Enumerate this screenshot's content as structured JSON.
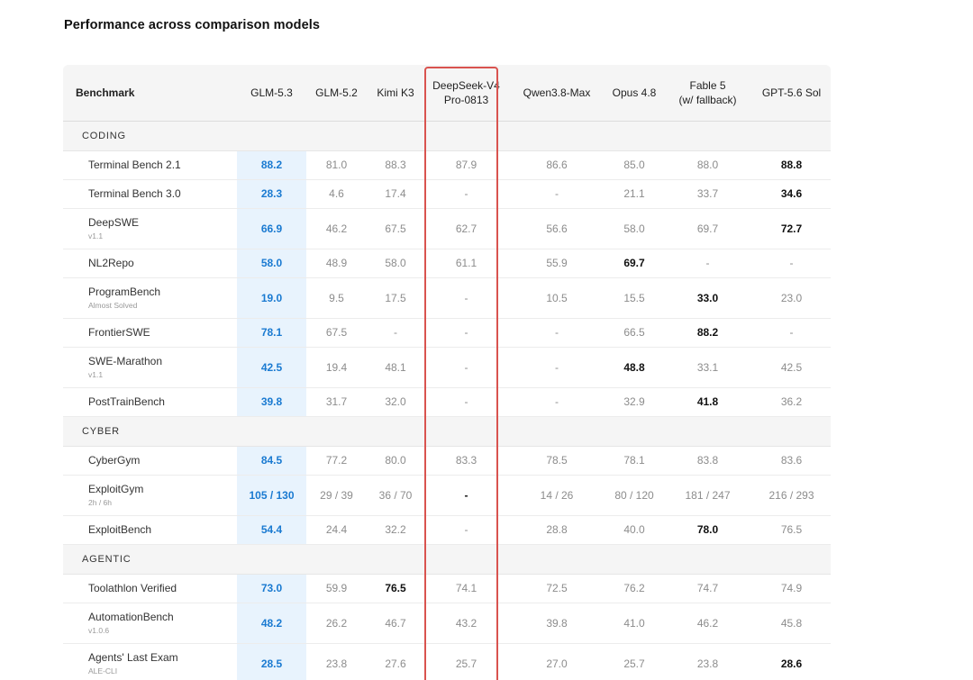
{
  "title": "Performance across comparison models",
  "columns": [
    {
      "label": "Benchmark"
    },
    {
      "label": "GLM-5.3"
    },
    {
      "label": "GLM-5.2"
    },
    {
      "label": "Kimi K3"
    },
    {
      "label": "DeepSeek-V4",
      "label2": "Pro-0813"
    },
    {
      "label": "Qwen3.8-Max"
    },
    {
      "label": "Opus 4.8"
    },
    {
      "label": "Fable 5",
      "label2": "(w/ fallback)"
    },
    {
      "label": "GPT-5.6 Sol"
    }
  ],
  "sections": [
    {
      "name": "CODING",
      "rows": [
        {
          "name": "Terminal Bench 2.1",
          "sub": "",
          "values": [
            "88.2",
            "81.0",
            "88.3",
            "87.9",
            "86.6",
            "85.0",
            "88.0",
            "88.8"
          ],
          "best": 7
        },
        {
          "name": "Terminal Bench 3.0",
          "sub": "",
          "values": [
            "28.3",
            "4.6",
            "17.4",
            "-",
            "-",
            "21.1",
            "33.7",
            "34.6"
          ],
          "best": 7
        },
        {
          "name": "DeepSWE",
          "sub": "v1.1",
          "values": [
            "66.9",
            "46.2",
            "67.5",
            "62.7",
            "56.6",
            "58.0",
            "69.7",
            "72.7"
          ],
          "best": 7
        },
        {
          "name": "NL2Repo",
          "sub": "",
          "values": [
            "58.0",
            "48.9",
            "58.0",
            "61.1",
            "55.9",
            "69.7",
            "-",
            "-"
          ],
          "best": 5
        },
        {
          "name": "ProgramBench",
          "sub": "Almost Solved",
          "values": [
            "19.0",
            "9.5",
            "17.5",
            "-",
            "10.5",
            "15.5",
            "33.0",
            "23.0"
          ],
          "best": 6
        },
        {
          "name": "FrontierSWE",
          "sub": "",
          "values": [
            "78.1",
            "67.5",
            "-",
            "-",
            "-",
            "66.5",
            "88.2",
            "-"
          ],
          "best": 6
        },
        {
          "name": "SWE-Marathon",
          "sub": "v1.1",
          "values": [
            "42.5",
            "19.4",
            "48.1",
            "-",
            "-",
            "48.8",
            "33.1",
            "42.5"
          ],
          "best": 5
        },
        {
          "name": "PostTrainBench",
          "sub": "",
          "values": [
            "39.8",
            "31.7",
            "32.0",
            "-",
            "-",
            "32.9",
            "41.8",
            "36.2"
          ],
          "best": 6
        }
      ]
    },
    {
      "name": "CYBER",
      "rows": [
        {
          "name": "CyberGym",
          "sub": "",
          "values": [
            "84.5",
            "77.2",
            "80.0",
            "83.3",
            "78.5",
            "78.1",
            "83.8",
            "83.6"
          ],
          "best": 0
        },
        {
          "name": "ExploitGym",
          "sub": "2h / 6h",
          "values": [
            "105 / 130",
            "29 / 39",
            "36 / 70",
            "-",
            "14 / 26",
            "80 / 120",
            "181 / 247",
            "216 / 293"
          ],
          "best": 3
        },
        {
          "name": "ExploitBench",
          "sub": "",
          "values": [
            "54.4",
            "24.4",
            "32.2",
            "-",
            "28.8",
            "40.0",
            "78.0",
            "76.5"
          ],
          "best": 6
        }
      ]
    },
    {
      "name": "AGENTIC",
      "rows": [
        {
          "name": "Toolathlon Verified",
          "sub": "",
          "values": [
            "73.0",
            "59.9",
            "76.5",
            "74.1",
            "72.5",
            "76.2",
            "74.7",
            "74.9"
          ],
          "best": 2
        },
        {
          "name": "AutomationBench",
          "sub": "v1.0.6",
          "values": [
            "48.2",
            "26.2",
            "46.7",
            "43.2",
            "39.8",
            "41.0",
            "46.2",
            "45.8"
          ],
          "best": 0
        },
        {
          "name": "Agents' Last Exam",
          "sub": "ALE-CLI",
          "values": [
            "28.5",
            "23.8",
            "27.6",
            "25.7",
            "27.0",
            "25.7",
            "23.8",
            "28.6"
          ],
          "best": 7
        }
      ]
    }
  ]
}
